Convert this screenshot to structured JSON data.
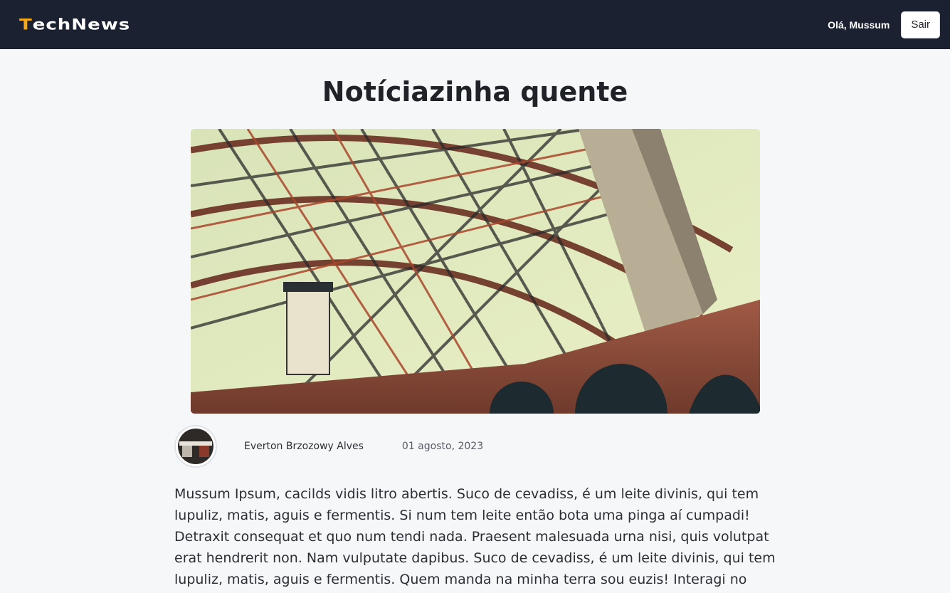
{
  "header": {
    "logo_first": "T",
    "logo_rest": "echNews",
    "greeting": "Olá, Mussum",
    "logout_label": "Sair"
  },
  "article": {
    "title": "Notíciazinha quente",
    "author": "Everton Brzozowy Alves",
    "date": "01 agosto, 2023",
    "body": "Mussum Ipsum, cacilds vidis litro abertis. Suco de cevadiss, é um leite divinis, qui tem lupuliz, matis, aguis e fermentis. Si num tem leite então bota uma pinga aí cumpadi! Detraxit consequat et quo num tendi nada. Praesent malesuada urna nisi, quis volutpat erat hendrerit non. Nam vulputate dapibus. Suco de cevadiss, é um leite divinis, qui tem lupuliz, matis, aguis e fermentis. Quem manda na minha terra sou euzis! Interagi no mé, cursus quis, vehicula ac nisi. Viva Forevis"
  },
  "colors": {
    "navbar": "#1b2130",
    "accent": "#f5a81c",
    "page_bg": "#f6f7f9"
  }
}
